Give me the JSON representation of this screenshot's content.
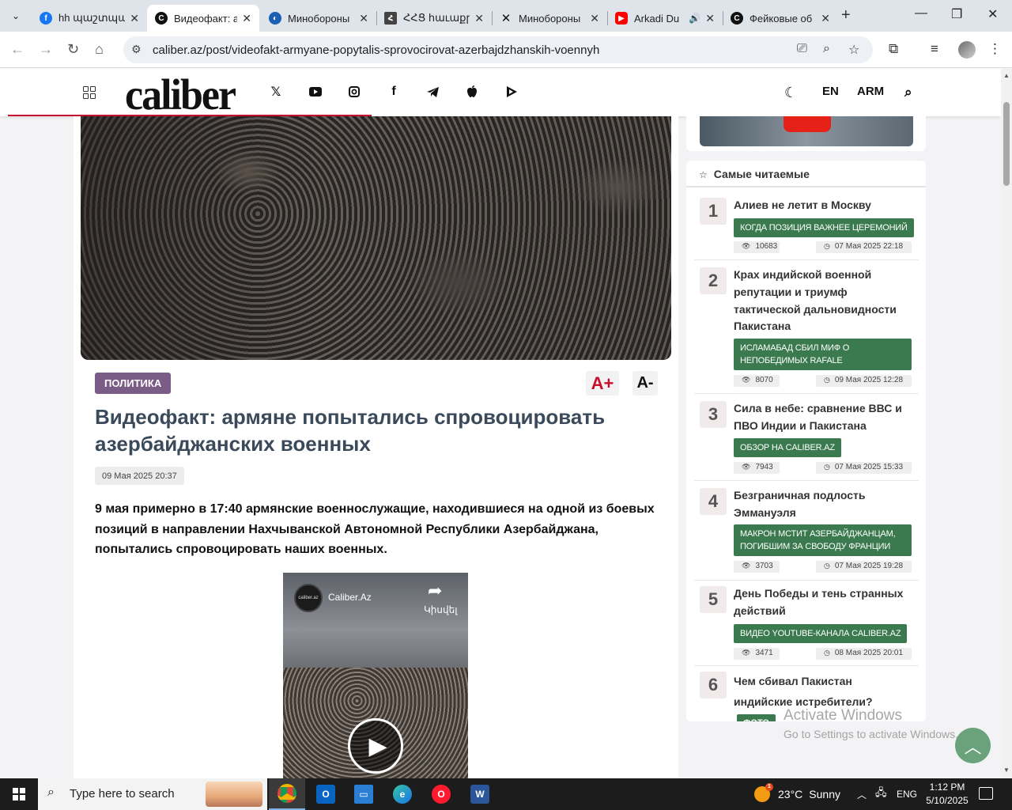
{
  "browser": {
    "tabs": [
      {
        "title": "hh պաշտպանությ",
        "icon": "facebook-icon",
        "color": "#1877f2",
        "active": false
      },
      {
        "title": "Видеофакт: армяне",
        "icon": "caliber-icon",
        "color": "#111111",
        "active": true
      },
      {
        "title": "Минобороны",
        "icon": "mod-icon",
        "color": "#1a5fb4",
        "active": false
      },
      {
        "title": "ՀՀՑ հաւաքր",
        "icon": "hhc-icon",
        "color": "#444444",
        "active": false
      },
      {
        "title": "Минобороны",
        "icon": "x-logo-icon",
        "color": "#111111",
        "active": false
      },
      {
        "title": "Arkadi Du",
        "icon": "youtube-icon",
        "color": "#ff0000",
        "active": false
      },
      {
        "title": "Фейковые об",
        "icon": "caliber-icon",
        "color": "#111111",
        "active": false
      }
    ],
    "url": "caliber.az/post/videofakt-armyane-popytalis-sprovocirovat-azerbajdzhanskih-voennyh"
  },
  "site": {
    "logo": "caliber",
    "lang_en": "EN",
    "lang_arm": "ARM",
    "accent_color": "#c8102e"
  },
  "article": {
    "category": "ПОЛИТИКА",
    "font_plus": "A+",
    "font_minus": "A-",
    "title": "Видеофакт: армяне попытались спровоцировать азербайджанских военных",
    "date": "09 Мая 2025 20:37",
    "lead": "9 мая примерно в 17:40 армянские военнослужащие, находившиеся на одной из боевых позиций в направлении Нахчыванской Автономной Республики Азербайджана, попытались спровоцировать наших военных."
  },
  "video": {
    "channel_logo": "caliber.az",
    "channel": "Caliber.Az",
    "share": "Կիսվել"
  },
  "sidebar": {
    "heading": "Самые читаемые",
    "items": [
      {
        "num": "1",
        "title": "Алиев не летит в Москву",
        "tag": "КОГДА ПОЗИЦИЯ ВАЖНЕЕ ЦЕРЕМОНИЙ",
        "views": "10683",
        "time": "07 Мая 2025 22:18"
      },
      {
        "num": "2",
        "title": "Крах индийской военной репутации и триумф тактической дальновидности Пакистана",
        "tag": "ИСЛАМАБАД СБИЛ МИФ О НЕПОБЕДИМЫХ RAFALE",
        "views": "8070",
        "time": "09 Мая 2025 12:28"
      },
      {
        "num": "3",
        "title": "Сила в небе: сравнение ВВС и ПВО Индии и Пакистана",
        "tag": "ОБЗОР НА CALIBER.AZ",
        "views": "7943",
        "time": "07 Мая 2025 15:33"
      },
      {
        "num": "4",
        "title": "Безграничная подлость Эммануэля",
        "tag": "МАКРОН МСТИТ АЗЕРБАЙДЖАНЦАМ, ПОГИБШИМ ЗА СВОБОДУ ФРАНЦИИ",
        "views": "3703",
        "time": "07 Мая 2025 19:28"
      },
      {
        "num": "5",
        "title": "День Победы и тень странных действий",
        "tag": "ВИДЕО YOUTUBE-КАНАЛА CALIBER.AZ",
        "views": "3471",
        "time": "08 Мая 2025 20:01"
      },
      {
        "num": "6",
        "title": "Чем сбивал Пакистан индийские истребители?",
        "tag": "ФОТО"
      }
    ]
  },
  "watermark": {
    "line1": "Activate Windows",
    "line2": "Go to Settings to activate Windows."
  },
  "taskbar": {
    "search_placeholder": "Type here to search",
    "temperature": "23°C",
    "weather": "Sunny",
    "language": "ENG",
    "time": "1:12 PM",
    "date": "5/10/2025"
  }
}
